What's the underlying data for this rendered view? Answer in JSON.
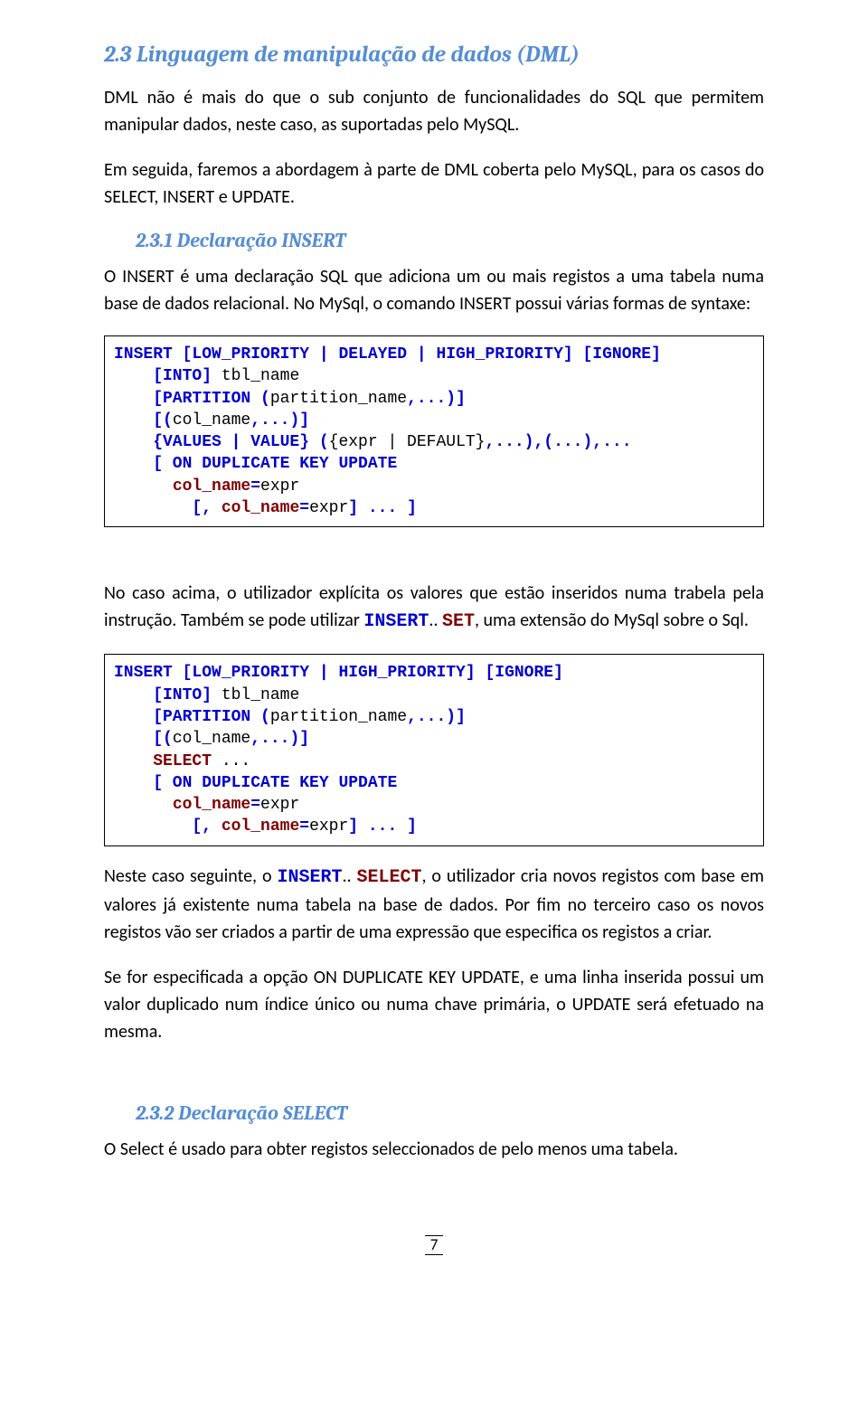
{
  "h2_1": "2.3 Linguagem de manipulação de dados (DML)",
  "p1": "DML não é mais do que o sub conjunto de funcionalidades do SQL que permitem manipular dados, neste caso, as suportadas pelo MySQL.",
  "p2": "Em seguida, faremos a abordagem à parte de DML coberta pelo MySQL, para os casos do SELECT, INSERT e UPDATE.",
  "h3_1": "2.3.1 Declaração INSERT",
  "p3": "O INSERT é uma declaração SQL que adiciona um ou mais registos a uma tabela numa base de dados relacional. No MySql, o comando INSERT possui várias formas de syntaxe:",
  "code1": {
    "l1a": "INSERT [LOW_PRIORITY | DELAYED | HIGH_PRIORITY] [IGNORE]",
    "l2a": "    [INTO]",
    "l2b": " tbl_name",
    "l3a": "    [PARTITION (",
    "l3b": "partition_name",
    "l3c": ",...)]",
    "l4a": "    [(",
    "l4b": "col_name",
    "l4c": ",...)]",
    "l5a": "    {VALUES | VALUE} (",
    "l5b": "{expr | DEFAULT}",
    "l5c": ",...),(...),...",
    "l6a": "    [ ON DUPLICATE KEY UPDATE",
    "l7a": "      ",
    "l7b": "col_name",
    "l7c": "=",
    "l7d": "expr",
    "l8a": "        [, ",
    "l8b": "col_name",
    "l8c": "=",
    "l8d": "expr",
    "l8e": "] ... ]"
  },
  "p4_pre": "No caso acima, o utilizador explícita os valores que estão inseridos numa trabela pela instrução. Também se pode utilizar ",
  "p4_ins": "INSERT",
  "p4_mid": ".. ",
  "p4_set": "SET",
  "p4_post": ", uma extensão do MySql sobre o Sql.",
  "code2": {
    "l1": "INSERT [LOW_PRIORITY | HIGH_PRIORITY] [IGNORE]",
    "l2a": "    [INTO]",
    "l2b": " tbl_name",
    "l3a": "    [PARTITION (",
    "l3b": "partition_name",
    "l3c": ",...)]",
    "l4a": "    [(",
    "l4b": "col_name",
    "l4c": ",...)]",
    "l5a": "    SELECT",
    "l5b": " ...",
    "l6": "    [ ON DUPLICATE KEY UPDATE",
    "l7a": "      ",
    "l7b": "col_name",
    "l7c": "=",
    "l7d": "expr",
    "l8a": "        [, ",
    "l8b": "col_name",
    "l8c": "=",
    "l8d": "expr",
    "l8e": "] ... ]"
  },
  "p5_pre": "Neste caso seguinte, o ",
  "p5_ins": "INSERT",
  "p5_mid": ".. ",
  "p5_sel": "SELECT",
  "p5_post": ", o utilizador cria novos registos com base em valores já existente numa tabela na base de dados. Por fim no terceiro caso os novos registos vão ser criados a partir de uma expressão que especifica os registos a criar.",
  "p6": "Se for especificada a opção ON DUPLICATE KEY UPDATE, e uma linha inserida possui um valor duplicado num índice único ou numa chave primária, o UPDATE será efetuado na mesma.",
  "h3_2": "2.3.2 Declaração SELECT",
  "p7": "O Select é usado para obter registos seleccionados de pelo menos uma tabela.",
  "page_number": "7"
}
